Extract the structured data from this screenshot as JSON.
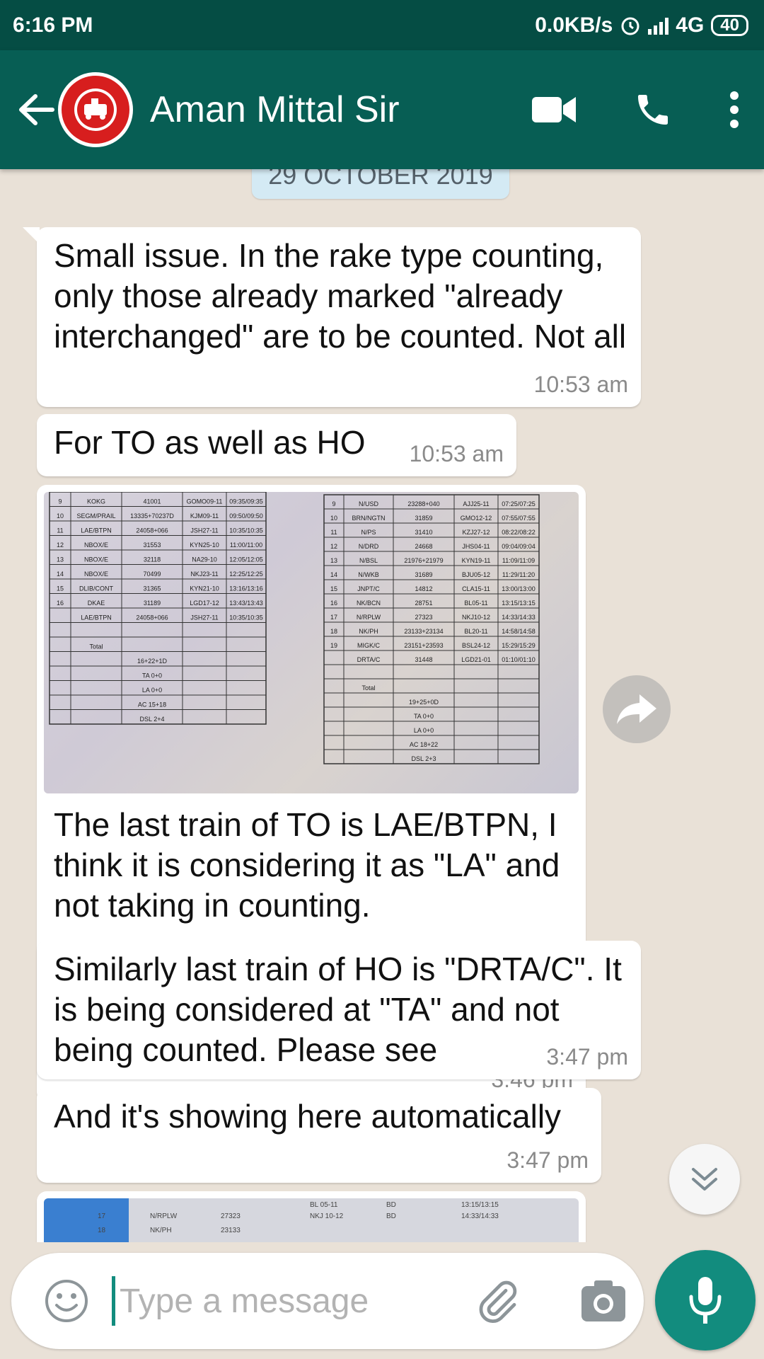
{
  "status_bar": {
    "time": "6:16 PM",
    "net_speed": "0.0KB/s",
    "network": "4G",
    "battery": "40"
  },
  "header": {
    "contact_name": "Aman Mittal Sir",
    "icons": [
      "back-arrow-icon",
      "indian-railways-logo",
      "video-call-icon",
      "phone-icon",
      "more-vert-icon"
    ]
  },
  "chat": {
    "date_chip": "29 OCTOBER 2019",
    "messages": [
      {
        "text": "Small issue. In the rake type counting, only those already marked \"already interchanged\" are to be counted. Not all",
        "time": "10:53 am"
      },
      {
        "text": "For TO as well as HO",
        "time": "10:53 am"
      },
      {
        "type": "image",
        "caption": "The last train of TO is LAE/BTPN, I think it is considering it as \"LA\" and not taking in counting.",
        "time": "3:46 pm"
      },
      {
        "text": "Similarly last train of HO is \"DRTA/C\". It is being considered at \"TA\" and not being counted. Please see",
        "time": "3:47 pm"
      },
      {
        "text": "And it's showing here automatically",
        "time": "3:47 pm"
      },
      {
        "type": "image"
      }
    ]
  },
  "photo_table": {
    "left_rows": [
      [
        "9",
        "KOKG",
        "41001",
        "GOMO09-11",
        "09:35/09:35"
      ],
      [
        "10",
        "SEGM/PRAIL",
        "13335+70237D",
        "KJM09-11",
        "09:50/09:50"
      ],
      [
        "11",
        "LAE/BTPN",
        "24058+066",
        "JSH27-11",
        "10:35/10:35"
      ],
      [
        "12",
        "NBOX/E",
        "31553",
        "KYN25-10",
        "11:00/11:00"
      ],
      [
        "13",
        "NBOX/E",
        "32118",
        "NA29-10",
        "12:05/12:05"
      ],
      [
        "14",
        "NBOX/E",
        "70499",
        "NKJ23-11",
        "12:25/12:25"
      ],
      [
        "15",
        "DLIB/CONT",
        "31365",
        "KYN21-10",
        "13:16/13:16"
      ],
      [
        "16",
        "DKAE",
        "31189",
        "LGD17-12",
        "13:43/13:43"
      ],
      [
        "",
        "LAE/BTPN",
        "24058+066",
        "JSH27-11",
        "10:35/10:35"
      ]
    ],
    "left_summary": [
      "Total",
      "16+22+1D",
      "TA 0+0",
      "LA 0+0",
      "AC 15+18",
      "DSL 2+4"
    ],
    "right_rows": [
      [
        "9",
        "N/USD",
        "23288+040",
        "AJJ25-11",
        "07:25/07:25"
      ],
      [
        "10",
        "BRN/NGTN",
        "31859",
        "GMO12-12",
        "07:55/07:55"
      ],
      [
        "11",
        "N/PS",
        "31410",
        "KZJ27-12",
        "08:22/08:22"
      ],
      [
        "12",
        "N/DRD",
        "24668",
        "JHS04-11",
        "09:04/09:04"
      ],
      [
        "13",
        "N/BSL",
        "21976+21979",
        "KYN19-11",
        "11:09/11:09"
      ],
      [
        "14",
        "N/WKB",
        "31689",
        "BJU05-12",
        "11:29/11:20"
      ],
      [
        "15",
        "JNPT/C",
        "14812",
        "CLA15-11",
        "13:00/13:00"
      ],
      [
        "16",
        "NK/BCN",
        "28751",
        "BL05-11",
        "13:15/13:15"
      ],
      [
        "17",
        "N/RPLW",
        "27323",
        "NKJ10-12",
        "14:33/14:33"
      ],
      [
        "18",
        "NK/PH",
        "23133+23134",
        "BL20-11",
        "14:58/14:58"
      ],
      [
        "19",
        "MIGK/C",
        "23151+23593",
        "BSL24-12",
        "15:29/15:29"
      ],
      [
        "",
        "DRTA/C",
        "31448",
        "LGD21-01",
        "01:10/01:10"
      ]
    ],
    "right_summary": [
      "Total",
      "19+25+0D",
      "TA 0+0",
      "LA 0+0",
      "AC 18+22",
      "DSL 2+3"
    ]
  },
  "photo2_text": {
    "row_a": [
      "17",
      "N/RPLW",
      "27323",
      "NKJ 10-12",
      "BD",
      "14:33/14:33"
    ],
    "row_top": [
      "BL 05-11",
      "BD",
      "13:15/13:15"
    ],
    "row_b": [
      "18",
      "NK/PH",
      "23133"
    ]
  },
  "input": {
    "placeholder": "Type a message"
  }
}
